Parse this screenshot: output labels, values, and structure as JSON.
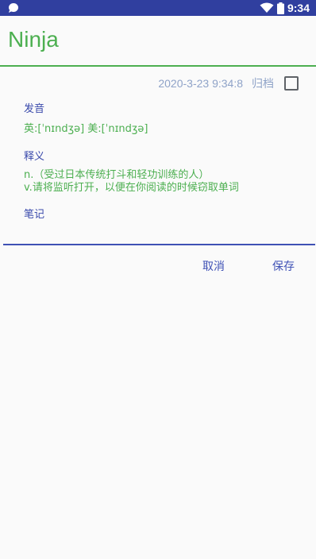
{
  "status_bar": {
    "time": "9:34",
    "icons": [
      "app-notification-icon",
      "wifi-icon",
      "battery-icon"
    ]
  },
  "app_bar": {
    "title": "Ninja"
  },
  "entry": {
    "timestamp": "2020-3-23 9:34:8",
    "archive_label": "归档",
    "archive_checked": false,
    "pronunciation_label": "发音",
    "pronunciation": "英:[ˈnɪndʒə] 美:[ˈnɪndʒə]",
    "definition_label": "释义",
    "definition_lines": [
      "n.（受过日本传统打斗和轻功训练的人）",
      "v.请将监听打开，以便在你阅读的时候窃取单词"
    ],
    "notes_label": "笔记"
  },
  "actions": {
    "cancel_label": "取消",
    "save_label": "保存"
  },
  "colors": {
    "status_bar": "#303f9f",
    "accent_green": "#4caf50",
    "primary_blue": "#3f51b5",
    "meta_grey_blue": "#8fa3c8",
    "background": "#fafafa"
  }
}
